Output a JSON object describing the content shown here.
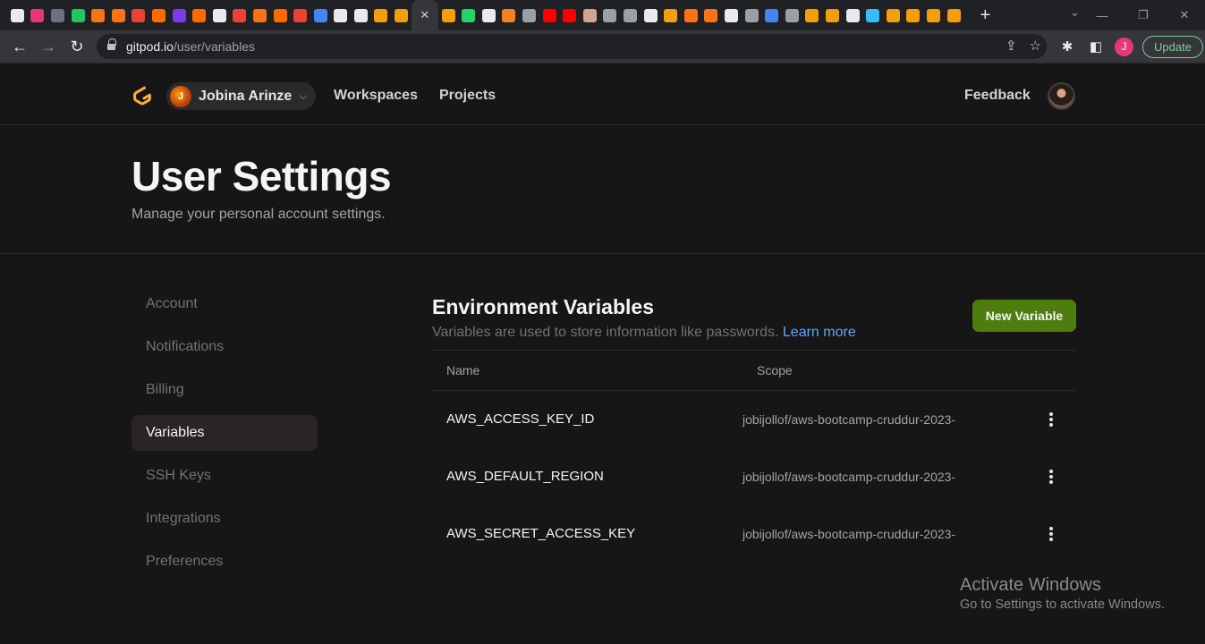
{
  "browser": {
    "tab_favicon_colors": [
      "#e8eaed",
      "#e5387a",
      "#6b7280",
      "#22c55e",
      "#f97316",
      "#f97316",
      "#ea4335",
      "#ff6a00",
      "#7c3aed",
      "#ff6a00",
      "#e8eaed",
      "#ea4335",
      "#f97316",
      "#ff6a00",
      "#ea4335",
      "#4285f4",
      "#e8eaed",
      "#e8eaed",
      "#f59e0b",
      "#f59e0b",
      "#f59e0b",
      "#25d366",
      "#e8eaed",
      "#f48024",
      "#9aa0a6",
      "#ff0000",
      "#ff0000",
      "#d4a58a",
      "#9aa0a6",
      "#9aa0a6",
      "#e8eaed",
      "#f59e0b",
      "#f97316",
      "#f97316",
      "#e8eaed",
      "#9aa0a6",
      "#4285f4",
      "#9aa0a6",
      "#f59e0b",
      "#f59e0b",
      "#e8eaed",
      "#38bdf8",
      "#f59e0b",
      "#f59e0b",
      "#f59e0b",
      "#f59e0b"
    ],
    "tab_close_glyph": "✕",
    "new_tab_glyph": "+",
    "url_host": "gitpod.io",
    "url_path": "/user/variables",
    "profile_initial": "J",
    "update_label": "Update",
    "accent_color": "#81c995"
  },
  "header": {
    "org_initial": "J",
    "org_name": "Jobina Arinze",
    "nav": [
      "Workspaces",
      "Projects"
    ],
    "feedback": "Feedback"
  },
  "page": {
    "title": "User Settings",
    "subtitle": "Manage your personal account settings."
  },
  "sidebar": {
    "items": [
      {
        "label": "Account",
        "active": false
      },
      {
        "label": "Notifications",
        "active": false
      },
      {
        "label": "Billing",
        "active": false
      },
      {
        "label": "Variables",
        "active": true
      },
      {
        "label": "SSH Keys",
        "active": false
      },
      {
        "label": "Integrations",
        "active": false
      },
      {
        "label": "Preferences",
        "active": false
      }
    ]
  },
  "env": {
    "title": "Environment Variables",
    "description": "Variables are used to store information like passwords.",
    "learn_more": "Learn more",
    "new_button": "New Variable",
    "button_color": "#4d7c0f",
    "columns": {
      "name": "Name",
      "scope": "Scope"
    },
    "rows": [
      {
        "name": "AWS_ACCESS_KEY_ID",
        "scope": "jobijollof/aws-bootcamp-cruddur-2023-"
      },
      {
        "name": "AWS_DEFAULT_REGION",
        "scope": "jobijollof/aws-bootcamp-cruddur-2023-"
      },
      {
        "name": "AWS_SECRET_ACCESS_KEY",
        "scope": "jobijollof/aws-bootcamp-cruddur-2023-"
      }
    ]
  },
  "watermark": {
    "title": "Activate Windows",
    "subtitle": "Go to Settings to activate Windows."
  }
}
